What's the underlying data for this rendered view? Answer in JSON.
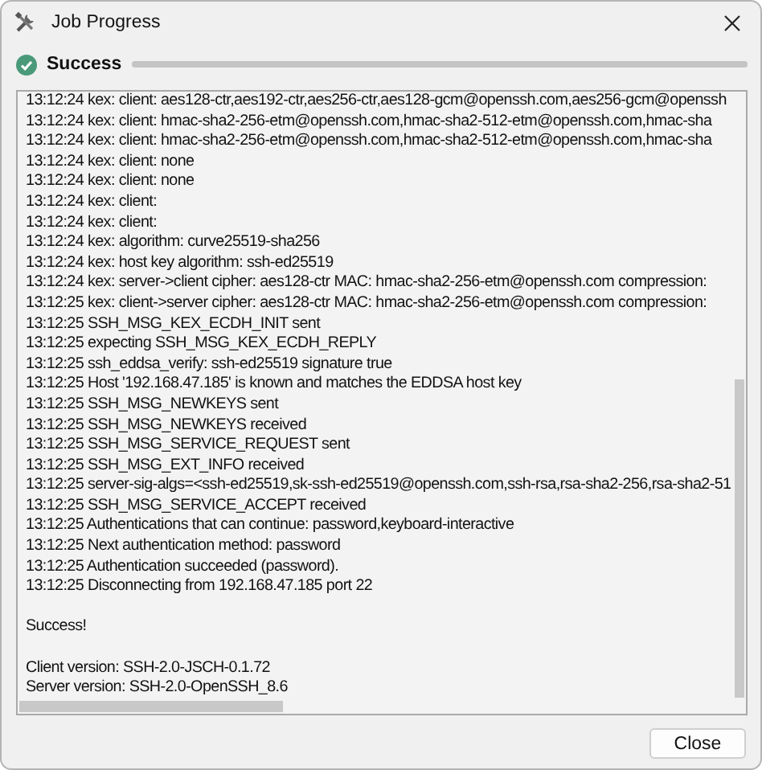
{
  "window": {
    "title": "Job Progress"
  },
  "status": {
    "label": "Success",
    "progress": {
      "level": 1
    }
  },
  "log": {
    "blocks": [
      [
        "13:12:24 kex: client: aes128-ctr,aes192-ctr,aes256-ctr,aes128-gcm@openssh.com,aes256-gcm@openssh",
        "13:12:24 kex: client: hmac-sha2-256-etm@openssh.com,hmac-sha2-512-etm@openssh.com,hmac-sha",
        "13:12:24 kex: client: hmac-sha2-256-etm@openssh.com,hmac-sha2-512-etm@openssh.com,hmac-sha",
        "13:12:24 kex: client: none",
        "13:12:24 kex: client: none",
        "13:12:24 kex: client:",
        "13:12:24 kex: client:",
        "13:12:24 kex: algorithm: curve25519-sha256",
        "13:12:24 kex: host key algorithm: ssh-ed25519",
        "13:12:24 kex: server->client cipher: aes128-ctr MAC: hmac-sha2-256-etm@openssh.com compression:",
        "13:12:25 kex: client->server cipher: aes128-ctr MAC: hmac-sha2-256-etm@openssh.com compression:",
        "13:12:25 SSH_MSG_KEX_ECDH_INIT sent",
        "13:12:25 expecting SSH_MSG_KEX_ECDH_REPLY",
        "13:12:25 ssh_eddsa_verify: ssh-ed25519 signature true",
        "13:12:25 Host '192.168.47.185' is known and matches the EDDSA host key",
        "13:12:25 SSH_MSG_NEWKEYS sent",
        "13:12:25 SSH_MSG_NEWKEYS received",
        "13:12:25 SSH_MSG_SERVICE_REQUEST sent",
        "13:12:25 SSH_MSG_EXT_INFO received",
        "13:12:25 server-sig-algs=<ssh-ed25519,sk-ssh-ed25519@openssh.com,ssh-rsa,rsa-sha2-256,rsa-sha2-51",
        "13:12:25 SSH_MSG_SERVICE_ACCEPT received",
        "13:12:25 Authentications that can continue: password,keyboard-interactive",
        "13:12:25 Next authentication method: password",
        "13:12:25 Authentication succeeded (password).",
        "13:12:25 Disconnecting from 192.168.47.185 port 22"
      ],
      [
        "Success!"
      ],
      [
        "Client version: SSH-2.0-JSCH-0.1.72",
        "Server version: SSH-2.0-OpenSSH_8.6"
      ]
    ]
  },
  "buttons": [
    {
      "label": "Close"
    }
  ]
}
